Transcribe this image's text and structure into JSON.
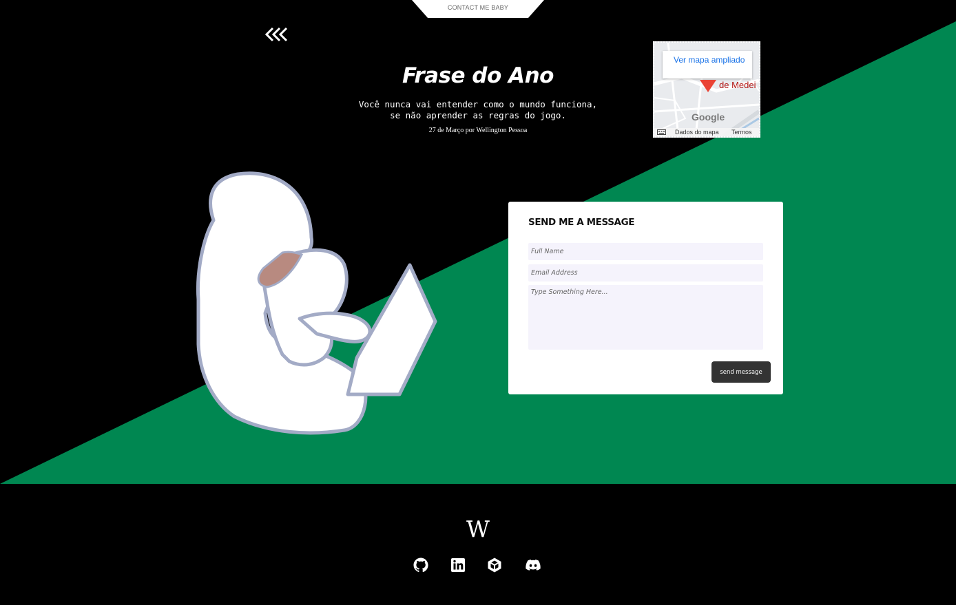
{
  "top_tab": {
    "label": "CONTACT ME BABY"
  },
  "nav": {
    "back_icon": "triple-chevron-left-icon"
  },
  "quote": {
    "title": "Frase do Ano",
    "line1": "Você nunca vai entender como o mundo funciona,",
    "line2": "se não aprender as regras do jogo.",
    "meta": "27 de Março por Wellington Pessoa"
  },
  "map": {
    "link_label": "Ver mapa ampliado",
    "place_label": "de Medei",
    "brand": "Google",
    "data_label": "Dados do mapa",
    "terms_label": "Termos"
  },
  "contact": {
    "title": "SEND ME A MESSAGE",
    "name_placeholder": "Full Name",
    "email_placeholder": "Email Address",
    "message_placeholder": "Type Something Here...",
    "send_label": "send message"
  },
  "footer": {
    "logo": "W",
    "social": [
      "github-icon",
      "linkedin-icon",
      "unity-icon",
      "discord-icon"
    ]
  },
  "colors": {
    "accent_green": "#008751",
    "background": "#000000",
    "button": "#333333"
  }
}
